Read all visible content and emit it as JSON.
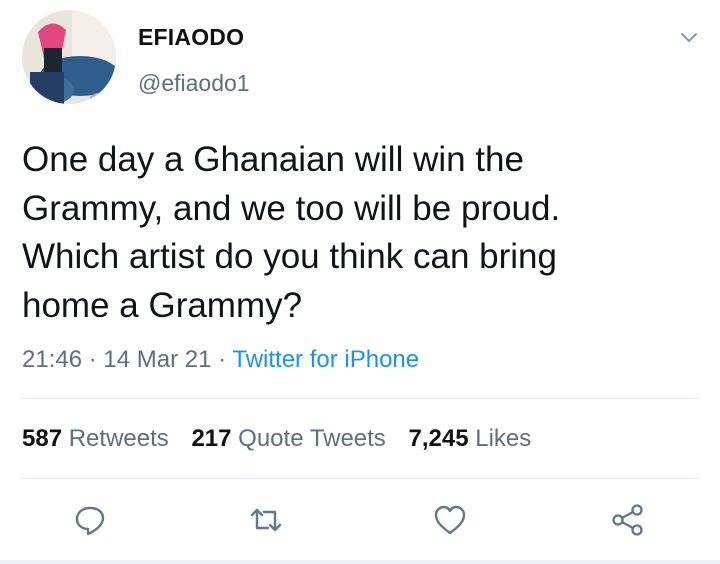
{
  "tweet": {
    "display_name": "EFIAODO",
    "handle": "@efiaodo1",
    "text_lines": [
      "One day a Ghanaian will win the",
      "Grammy, and we too will be proud.",
      "Which artist do you think can bring",
      "home a Grammy?"
    ],
    "time": "21:46",
    "date": "14 Mar 21",
    "separator": "·",
    "source": "Twitter for iPhone"
  },
  "stats": {
    "retweets": {
      "count": "587",
      "label": "Retweets"
    },
    "quotes": {
      "count": "217",
      "label": "Quote Tweets"
    },
    "likes": {
      "count": "7,245",
      "label": "Likes"
    }
  },
  "icons": {
    "more": "chevron-down-icon",
    "reply": "reply-icon",
    "retweet": "retweet-icon",
    "like": "heart-icon",
    "share": "share-icon"
  },
  "colors": {
    "text": "#0f1419",
    "secondary": "#5b7083",
    "link": "#1b95e0",
    "divider": "#e1e8ed"
  }
}
